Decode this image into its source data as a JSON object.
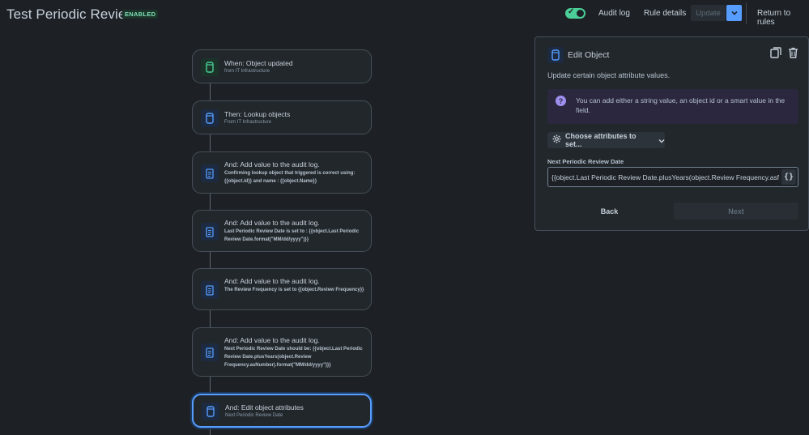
{
  "header": {
    "title": "Test Periodic Review",
    "status_badge": "ENABLED",
    "audit_log_label": "Audit log",
    "rule_details_label": "Rule details",
    "update_label": "Update",
    "return_label": "Return to rules"
  },
  "colors": {
    "accent": "#579dff",
    "enabled": "#4bce97",
    "background": "#1d2125"
  },
  "flow": {
    "nodes": [
      {
        "title": "When: Object updated",
        "subtitle": "from IT Infrastructure",
        "icon": "object-icon"
      },
      {
        "title": "Then: Lookup objects",
        "subtitle": "From IT Infrastructure",
        "icon": "object-icon"
      },
      {
        "title": "And: Add value to the audit log.",
        "description": "Confirming lookup object that triggered is correct using: {{object.id}} and name : {{object.Name}}",
        "icon": "audit-log-icon"
      },
      {
        "title": "And: Add value to the audit log.",
        "description": "Last Periodic Review Date is set to : {{object.Last Periodic Review Date.format(\"MM/dd/yyyy\")}}",
        "icon": "audit-log-icon"
      },
      {
        "title": "And: Add value to the audit log.",
        "description": "The Review Frequency is set to {{object.Review Frequency}}",
        "icon": "audit-log-icon"
      },
      {
        "title": "And: Add value to the audit log.",
        "description": "Next Periodic Review Date should be: {{object.Last Periodic Review Date.plusYears(object.Review Frequency.asNumber).format(\"MM/dd/yyyy\")}}",
        "icon": "audit-log-icon"
      },
      {
        "title": "And: Edit object attributes",
        "subtitle": "Next Periodic Review Date",
        "icon": "object-icon"
      }
    ]
  },
  "panel": {
    "title": "Edit Object",
    "description": "Update certain object attribute values.",
    "info": "You can add either a string value, an object id or a smart value in the field.",
    "choose_label": "Choose attributes to set...",
    "field_label": "Next Periodic Review Date",
    "field_value": "{{object.Last Periodic Review Date.plusYears(object.Review Frequency.asNumber).format(\"MM/dd/yyyy\")}}",
    "smart_value_label": "{}",
    "back_label": "Back",
    "next_label": "Next"
  }
}
